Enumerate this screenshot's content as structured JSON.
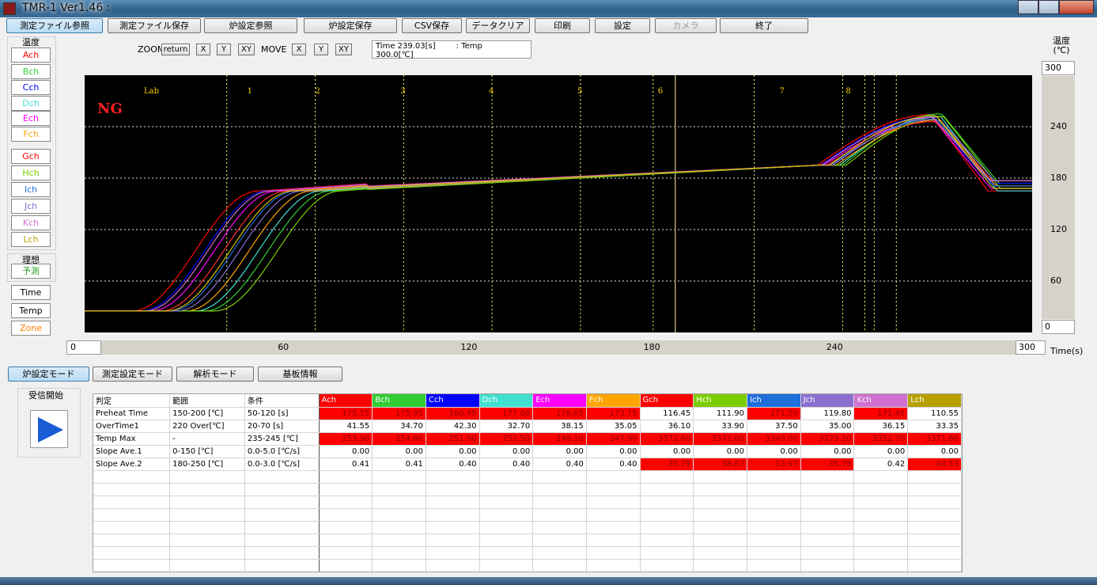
{
  "window": {
    "title": "TMR-1 Ver1.46 :"
  },
  "toolbar": [
    {
      "label": "測定ファイル参照",
      "active": true,
      "disabled": false
    },
    {
      "label": "測定ファイル保存",
      "active": false,
      "disabled": false
    },
    {
      "label": "炉設定参照",
      "active": false,
      "disabled": false
    },
    {
      "label": "炉設定保存",
      "active": false,
      "disabled": false
    },
    {
      "label": "CSV保存",
      "active": false,
      "disabled": false
    },
    {
      "label": "データクリア",
      "active": false,
      "disabled": false
    },
    {
      "label": "印刷",
      "active": false,
      "disabled": false
    },
    {
      "label": "設定",
      "active": false,
      "disabled": false
    },
    {
      "label": "カメラ",
      "active": false,
      "disabled": true
    },
    {
      "label": "終了",
      "active": false,
      "disabled": false
    }
  ],
  "left": {
    "temp_label": "温度",
    "channels": [
      {
        "label": "Ach",
        "color": "#ff0000"
      },
      {
        "label": "Bch",
        "color": "#32cd32"
      },
      {
        "label": "Cch",
        "color": "#0000ff"
      },
      {
        "label": "Dch",
        "color": "#40e0d0"
      },
      {
        "label": "Ech",
        "color": "#ff00ff"
      },
      {
        "label": "Fch",
        "color": "#ffa500"
      },
      {
        "label": "Gch",
        "color": "#ff0000"
      },
      {
        "label": "Hch",
        "color": "#7ccd00"
      },
      {
        "label": "Ich",
        "color": "#1e6fd9"
      },
      {
        "label": "Jch",
        "color": "#8a6fd0"
      },
      {
        "label": "Kch",
        "color": "#d070d0"
      },
      {
        "label": "Lch",
        "color": "#b8a000"
      }
    ],
    "ideal_label": "理想",
    "predict_label": "予測",
    "predict_color": "#2f9f2f",
    "time_label": "Time",
    "temp_btn_label": "Temp",
    "zone_label": "Zone",
    "zone_color": "#ff8000"
  },
  "zoom": {
    "zoom_label": "ZOOM",
    "return_label": "return",
    "x_label": "X",
    "y_label": "Y",
    "xy_label": "XY",
    "move_label": "MOVE"
  },
  "readout": {
    "time": "Time  239.03[s]",
    "temp": ": Temp  300.0[℃]"
  },
  "axis": {
    "y_unit_line1": "温度",
    "y_unit_line2": "(℃)",
    "y_max": "300",
    "y_min": "0",
    "y_ticks": [
      "240",
      "180",
      "120",
      "60"
    ],
    "x_min": "0",
    "x_max": "300",
    "x_ticks": [
      "60",
      "120",
      "180",
      "240"
    ],
    "x_unit": "Time(s)"
  },
  "chart_data": {
    "type": "line",
    "status_text": "NG",
    "status_color": "#ff2020",
    "lab_label": "Lab",
    "zone_labels": [
      "1",
      "2",
      "3",
      "4",
      "5",
      "6",
      "7",
      "8"
    ],
    "zone_boundaries_s": [
      45,
      73,
      101,
      129,
      157,
      180,
      212,
      240,
      247,
      250,
      257
    ],
    "cursor_s": 187,
    "xlim": [
      0,
      300
    ],
    "ylim": [
      0,
      300
    ],
    "grid": true,
    "series": [
      {
        "name": "Ach",
        "color": "#ff0000",
        "lag": 0,
        "peak": 254
      },
      {
        "name": "Bch",
        "color": "#32cd32",
        "lag": 23,
        "peak": 255
      },
      {
        "name": "Cch",
        "color": "#0000ff",
        "lag": 3,
        "peak": 252
      },
      {
        "name": "Dch",
        "color": "#40e0d0",
        "lag": 20,
        "peak": 252
      },
      {
        "name": "Ech",
        "color": "#ff00ff",
        "lag": 6,
        "peak": 248
      },
      {
        "name": "Fch",
        "color": "#ffa500",
        "lag": 17,
        "peak": 248
      },
      {
        "name": "Gch",
        "color": "#ff3030",
        "lag": 9,
        "peak": 246
      },
      {
        "name": "Hch",
        "color": "#7ccd00",
        "lag": 26,
        "peak": 252
      },
      {
        "name": "Ich",
        "color": "#1e6fd9",
        "lag": 12,
        "peak": 249
      },
      {
        "name": "Jch",
        "color": "#8a6fd0",
        "lag": 14,
        "peak": 251
      },
      {
        "name": "Kch",
        "color": "#d070d0",
        "lag": 4,
        "peak": 251
      },
      {
        "name": "Lch",
        "color": "#d8c000",
        "lag": 11,
        "peak": 253
      }
    ]
  },
  "modes": [
    {
      "label": "炉設定モード",
      "active": true
    },
    {
      "label": "測定設定モード",
      "active": false
    },
    {
      "label": "解析モード",
      "active": false
    },
    {
      "label": "基板情報",
      "active": false
    }
  ],
  "receive": {
    "label": "受信開始"
  },
  "table": {
    "headers": [
      "判定",
      "範囲",
      "条件"
    ],
    "channel_headers": [
      {
        "label": "Ach",
        "color": "#ff0000"
      },
      {
        "label": "Bch",
        "color": "#32cd32"
      },
      {
        "label": "Cch",
        "color": "#0000ff"
      },
      {
        "label": "Dch",
        "color": "#40e0d0"
      },
      {
        "label": "Ech",
        "color": "#ff00ff"
      },
      {
        "label": "Fch",
        "color": "#ffa500"
      },
      {
        "label": "Gch",
        "color": "#ff0000"
      },
      {
        "label": "Hch",
        "color": "#7ccd00"
      },
      {
        "label": "Ich",
        "color": "#1e6fd9"
      },
      {
        "label": "Jch",
        "color": "#8a6fd0"
      },
      {
        "label": "Kch",
        "color": "#d070d0"
      },
      {
        "label": "Lch",
        "color": "#b8a000"
      }
    ],
    "rows": [
      {
        "name": "Preheat Time",
        "range": "150-200 [℃]",
        "cond": "50-120 [s]",
        "values": [
          "175.15",
          "175.95",
          "180.45",
          "177.80",
          "176.05",
          "173.75",
          "116.45",
          "111.90",
          "171.50",
          "119.80",
          "171.45",
          "110.55"
        ],
        "ng": [
          1,
          1,
          1,
          1,
          1,
          1,
          0,
          0,
          1,
          0,
          1,
          0
        ]
      },
      {
        "name": "OverTime1",
        "range": "220 Over[℃]",
        "cond": "20-70 [s]",
        "values": [
          "41.55",
          "34.70",
          "42.30",
          "32.70",
          "38.15",
          "35.05",
          "36.10",
          "33.90",
          "37.50",
          "35.00",
          "36.15",
          "33.35"
        ],
        "ng": [
          0,
          0,
          0,
          0,
          0,
          0,
          0,
          0,
          0,
          0,
          0,
          0
        ]
      },
      {
        "name": "Temp Max",
        "range": "-",
        "cond": "235-245 [℃]",
        "values": [
          "253.90",
          "254.60",
          "251.90",
          "252.50",
          "248.10",
          "247.90",
          "3372.60",
          "3372.00",
          "3349.00",
          "3373.20",
          "3352.70",
          "3371.60"
        ],
        "ng": [
          1,
          1,
          1,
          1,
          1,
          1,
          1,
          1,
          1,
          1,
          1,
          1
        ]
      },
      {
        "name": "Slope Ave.1",
        "range": "0-150 [℃]",
        "cond": "0.0-5.0 [℃/s]",
        "values": [
          "0.00",
          "0.00",
          "0.00",
          "0.00",
          "0.00",
          "0.00",
          "0.00",
          "0.00",
          "0.00",
          "0.00",
          "0.00",
          "0.00"
        ],
        "ng": [
          0,
          0,
          0,
          0,
          0,
          0,
          0,
          0,
          0,
          0,
          0,
          0
        ]
      },
      {
        "name": "Slope Ave.2",
        "range": "180-250 [℃]",
        "cond": "0.0-3.0 [℃/s]",
        "values": [
          "0.41",
          "0.41",
          "0.40",
          "0.40",
          "0.40",
          "0.40",
          "35.79",
          "38.67",
          "13.97",
          "35.78",
          "0.42",
          "40.53"
        ],
        "ng": [
          0,
          0,
          0,
          0,
          0,
          0,
          1,
          1,
          1,
          1,
          0,
          1
        ]
      }
    ],
    "empty_rows": 8
  }
}
